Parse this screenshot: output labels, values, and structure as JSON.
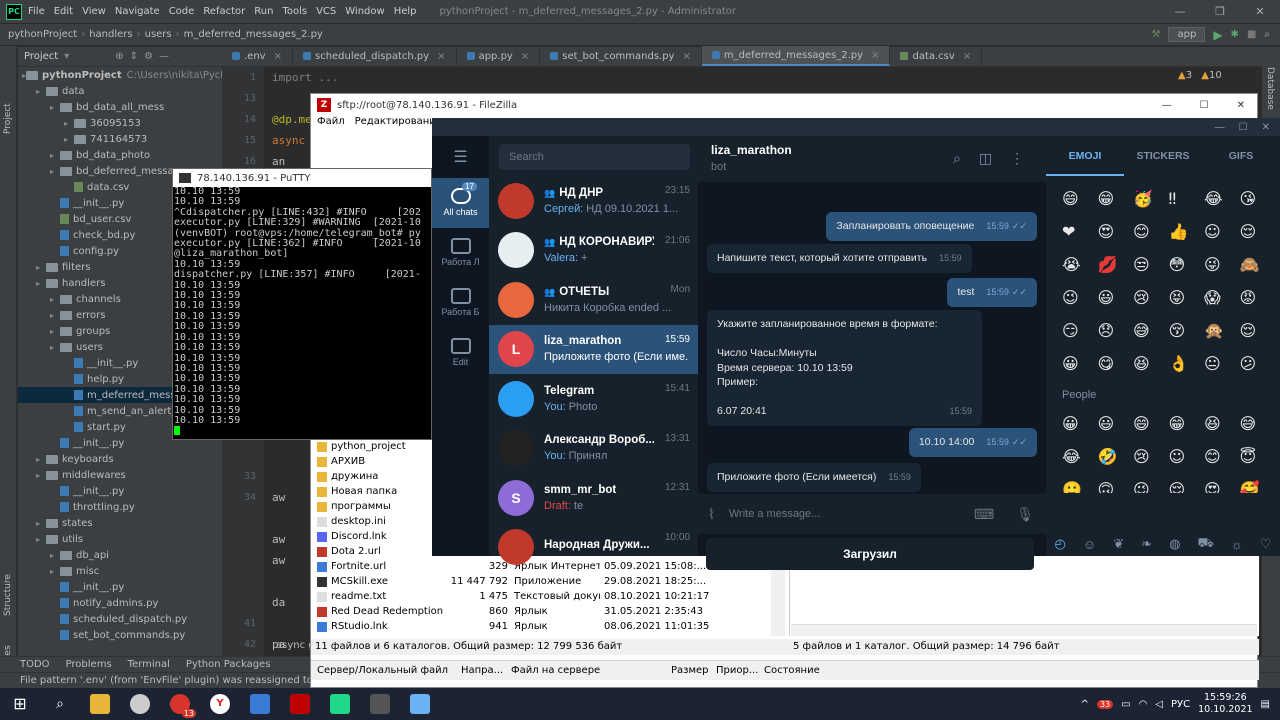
{
  "ide": {
    "title_menu": [
      "File",
      "Edit",
      "View",
      "Navigate",
      "Code",
      "Refactor",
      "Run",
      "Tools",
      "VCS",
      "Window",
      "Help"
    ],
    "window_title": "pythonProject - m_deferred_messages_2.py - Administrator",
    "breadcrumbs": [
      "pythonProject",
      "handlers",
      "users",
      "m_deferred_messages_2.py"
    ],
    "run_config": "app",
    "tabs": [
      ".env",
      "scheduled_dispatch.py",
      "app.py",
      "set_bot_commands.py",
      "m_deferred_messages_2.py",
      "data.csv"
    ],
    "project_label": "Project",
    "tree": [
      {
        "label": "pythonProject",
        "extra": "C:\\Users\\nikita\\Pycham",
        "kind": "folder",
        "depth": 0
      },
      {
        "label": "data",
        "kind": "folder",
        "depth": 1
      },
      {
        "label": "bd_data_all_mess",
        "kind": "folder",
        "depth": 2
      },
      {
        "label": "36095153",
        "kind": "folder",
        "depth": 3
      },
      {
        "label": "741164573",
        "kind": "folder",
        "depth": 3
      },
      {
        "label": "bd_data_photo",
        "kind": "folder",
        "depth": 2
      },
      {
        "label": "bd_deferred_message",
        "kind": "folder",
        "depth": 2
      },
      {
        "label": "data.csv",
        "kind": "csv",
        "depth": 3
      },
      {
        "label": "__init__.py",
        "kind": "py",
        "depth": 2
      },
      {
        "label": "bd_user.csv",
        "kind": "csv",
        "depth": 2
      },
      {
        "label": "check_bd.py",
        "kind": "py",
        "depth": 2
      },
      {
        "label": "config.py",
        "kind": "py",
        "depth": 2
      },
      {
        "label": "filters",
        "kind": "folder",
        "depth": 1
      },
      {
        "label": "handlers",
        "kind": "folder",
        "depth": 1
      },
      {
        "label": "channels",
        "kind": "folder",
        "depth": 2
      },
      {
        "label": "errors",
        "kind": "folder",
        "depth": 2
      },
      {
        "label": "groups",
        "kind": "folder",
        "depth": 2
      },
      {
        "label": "users",
        "kind": "folder",
        "depth": 2
      },
      {
        "label": "__init__.py",
        "kind": "py",
        "depth": 3
      },
      {
        "label": "help.py",
        "kind": "py",
        "depth": 3
      },
      {
        "label": "m_deferred_messa",
        "kind": "py",
        "depth": 3
      },
      {
        "label": "m_send_an_alert_",
        "kind": "py",
        "depth": 3
      },
      {
        "label": "start.py",
        "kind": "py",
        "depth": 3
      },
      {
        "label": "__init__.py",
        "kind": "py",
        "depth": 2
      },
      {
        "label": "keyboards",
        "kind": "folder",
        "depth": 1
      },
      {
        "label": "middlewares",
        "kind": "folder",
        "depth": 1
      },
      {
        "label": "__init__.py",
        "kind": "py",
        "depth": 2
      },
      {
        "label": "throttling.py",
        "kind": "py",
        "depth": 2
      },
      {
        "label": "states",
        "kind": "folder",
        "depth": 1
      },
      {
        "label": "utils",
        "kind": "folder",
        "depth": 1
      },
      {
        "label": "db_api",
        "kind": "folder",
        "depth": 2
      },
      {
        "label": "misc",
        "kind": "folder",
        "depth": 2
      },
      {
        "label": "__init__.py",
        "kind": "py",
        "depth": 2
      },
      {
        "label": "notify_admins.py",
        "kind": "py",
        "depth": 2
      },
      {
        "label": "scheduled_dispatch.py",
        "kind": "py",
        "depth": 2
      },
      {
        "label": "set_bot_commands.py",
        "kind": "py",
        "depth": 2
      }
    ],
    "line_numbers": [
      "1",
      "13",
      "14",
      "15",
      "16",
      "",
      "",
      "",
      "",
      "",
      "",
      "",
      "",
      "",
      "",
      "",
      "",
      "",
      "",
      "33",
      "34",
      "",
      "",
      "",
      "",
      "",
      "41",
      "42"
    ],
    "code_lines": [
      "import ...",
      "",
      "@dp.me",
      "async d",
      "      an",
      "",
      "",
      "",
      "",
      "",
      "",
      "",
      "",
      "",
      "",
      "",
      "",
      "",
      "",
      "",
      "      aw",
      "",
      "      aw",
      "      aw",
      "",
      "      da",
      "",
      "      pa",
      "      if"
    ],
    "inspection": {
      "warnings": "3",
      "weak": "10"
    },
    "bottom_tools": [
      "TODO",
      "Problems",
      "Terminal",
      "Python Packages"
    ],
    "bottom_trailing": "async g",
    "status_text": "File pattern '.env' (from 'EnvFile' plugin) was reassigned to file type '",
    "left_tools": [
      "Project",
      "Structure",
      "Favorites"
    ],
    "right_tools": [
      "Database"
    ]
  },
  "filezilla": {
    "title": "sftp://root@78.140.136.91 - FileZilla",
    "menu": [
      "Файл",
      "Редактирование"
    ],
    "local_files": [
      {
        "name": "python_project",
        "size": "",
        "type": "",
        "date": ""
      },
      {
        "name": "АРХИВ",
        "size": "",
        "type": "",
        "date": ""
      },
      {
        "name": "дружина",
        "size": "",
        "type": "",
        "date": ""
      },
      {
        "name": "Новая папка",
        "size": "",
        "type": "",
        "date": ""
      },
      {
        "name": "программы",
        "size": "",
        "type": "",
        "date": ""
      },
      {
        "name": "desktop.ini",
        "size": "",
        "type": "",
        "date": ""
      },
      {
        "name": "Discord.lnk",
        "size": "",
        "type": "",
        "date": ""
      },
      {
        "name": "Dota 2.url",
        "size": "",
        "type": "",
        "date": ""
      },
      {
        "name": "Fortnite.url",
        "size": "329",
        "type": "Ярлык Интернета",
        "date": "05.09.2021 15:08:..."
      },
      {
        "name": "MCSkill.exe",
        "size": "11 447 792",
        "type": "Приложение",
        "date": "29.08.2021 18:25:..."
      },
      {
        "name": "readme.txt",
        "size": "1 475",
        "type": "Текстовый докум...",
        "date": "08.10.2021 10:21:17"
      },
      {
        "name": "Red Dead Redemption 2.l...",
        "size": "860",
        "type": "Ярлык",
        "date": "31.05.2021 2:35:43"
      },
      {
        "name": "RStudio.lnk",
        "size": "941",
        "type": "Ярлык",
        "date": "08.06.2021 11:01:35"
      }
    ],
    "local_status": "11 файлов и 6 каталогов. Общий размер: 12 799 536 байт",
    "remote_status": "5 файлов и 1 каталог. Общий размер: 14 796 байт",
    "queue_headers": [
      "Сервер/Локальный файл",
      "Напра...",
      "Файл на сервере",
      "Размер",
      "Приор...",
      "Состояние"
    ]
  },
  "putty": {
    "title": "78.140.136.91 - PuTTY",
    "lines": [
      "10.10 13:59",
      "10.10 13:59",
      "^Cdispatcher.py [LINE:432] #INFO     [202",
      "executor.py [LINE:329] #WARNING  [2021-10",
      "(venvBOT) root@vps:/home/telegram_bot# py",
      "executor.py [LINE:362] #INFO     [2021-10",
      "@liza_marathon_bot]",
      "10.10 13:59",
      "dispatcher.py [LINE:357] #INFO     [2021-",
      "10.10 13:59",
      "10.10 13:59",
      "10.10 13:59",
      "10.10 13:59",
      "10.10 13:59",
      "10.10 13:59",
      "10.10 13:59",
      "10.10 13:59",
      "10.10 13:59",
      "10.10 13:59",
      "10.10 13:59",
      "10.10 13:59",
      "10.10 13:59",
      "10.10 13:59"
    ]
  },
  "telegram": {
    "search_placeholder": "Search",
    "folders": [
      {
        "label": "All chats",
        "badge": "17",
        "active": true
      },
      {
        "label": "Работа Л",
        "active": false
      },
      {
        "label": "Работа Б",
        "active": false
      },
      {
        "label": "Edit",
        "active": false
      }
    ],
    "chats": [
      {
        "name": "НД ДНР",
        "time": "23:15",
        "sender": "Сергей:",
        "text": "НД 09.10.2021 1...",
        "avatar": "",
        "color": "#c0392b",
        "group": true
      },
      {
        "name": "НД КОРОНАВИРУС",
        "time": "21:06",
        "sender": "Valera:",
        "text": "+",
        "avatar": "",
        "color": "#e6eef2",
        "group": true
      },
      {
        "name": "ОТЧЁТЫ",
        "time": "Mon",
        "sender": "",
        "text": "Никита Коробка ended ...",
        "avatar": "",
        "color": "#e8673c",
        "group": true
      },
      {
        "name": "liza_marathon",
        "time": "15:59",
        "sender": "",
        "text": "Приложите фото (Если име...",
        "avatar": "L",
        "color": "#e0454c",
        "group": false,
        "active": true
      },
      {
        "name": "Telegram",
        "time": "15:41",
        "sender": "You:",
        "text": "Photo",
        "avatar": "",
        "color": "#2a9ef1",
        "group": false
      },
      {
        "name": "Александр Вороб...",
        "time": "13:31",
        "sender": "You:",
        "text": "Принял",
        "avatar": "",
        "color": "#222",
        "group": false
      },
      {
        "name": "smm_mr_bot",
        "time": "12:31",
        "sender": "Draft:",
        "text": "te",
        "avatar": "S",
        "color": "#8e6bd6",
        "group": false
      },
      {
        "name": "Народная Дружи...",
        "time": "10:00",
        "sender": "",
        "text": "",
        "avatar": "",
        "color": "#c0392b",
        "group": false
      }
    ],
    "header": {
      "name": "liza_marathon",
      "status": "bot"
    },
    "messages": [
      {
        "dir": "out",
        "text": "Запланировать оповещение",
        "time": "15:59"
      },
      {
        "dir": "in",
        "text": "Напишите текст, который хотите отправить",
        "time": "15:59"
      },
      {
        "dir": "out",
        "text": "test",
        "time": "15:59"
      },
      {
        "dir": "in",
        "text": "Укажите запланированное время в формате:\n\nЧисло Часы:Минуты\nВремя сервера: 10.10 13:59\nПример:\n\n6.07 20:41",
        "time": "15:59"
      },
      {
        "dir": "out",
        "text": "10.10 14:00",
        "time": "15:59"
      },
      {
        "dir": "in",
        "text": "Приложите фото (Если имеется)",
        "time": "15:59"
      }
    ],
    "input_placeholder": "Write a message...",
    "upload_button": "Загрузил",
    "emoji_tabs": [
      "EMOJI",
      "STICKERS",
      "GIFS"
    ],
    "emoji_rows1": [
      "😄",
      "😁",
      "🥳",
      "‼",
      "😂",
      "😘",
      "❤",
      "😍",
      "😊",
      "👍",
      "☺",
      "😌",
      "😭",
      "💋",
      "😒",
      "😳",
      "😜",
      "🙈",
      "😉",
      "😃",
      "😢",
      "😝",
      "😱",
      "😡",
      "😏",
      "😞",
      "😅",
      "😚",
      "🙊",
      "😌",
      "😀",
      "😋",
      "😆",
      "👌",
      "😐",
      "😕"
    ],
    "emoji_category": "People",
    "emoji_rows2": [
      "😀",
      "😃",
      "😄",
      "😁",
      "😆",
      "😅",
      "😂",
      "🤣",
      "😢",
      "☺",
      "😊",
      "😇",
      "🙂",
      "🙃",
      "😉",
      "😌",
      "😍",
      "🥰"
    ]
  },
  "taskbar": {
    "lang": "РУС",
    "time": "15:59:26",
    "date": "10.10.2021",
    "badges": [
      "13",
      "33"
    ]
  }
}
